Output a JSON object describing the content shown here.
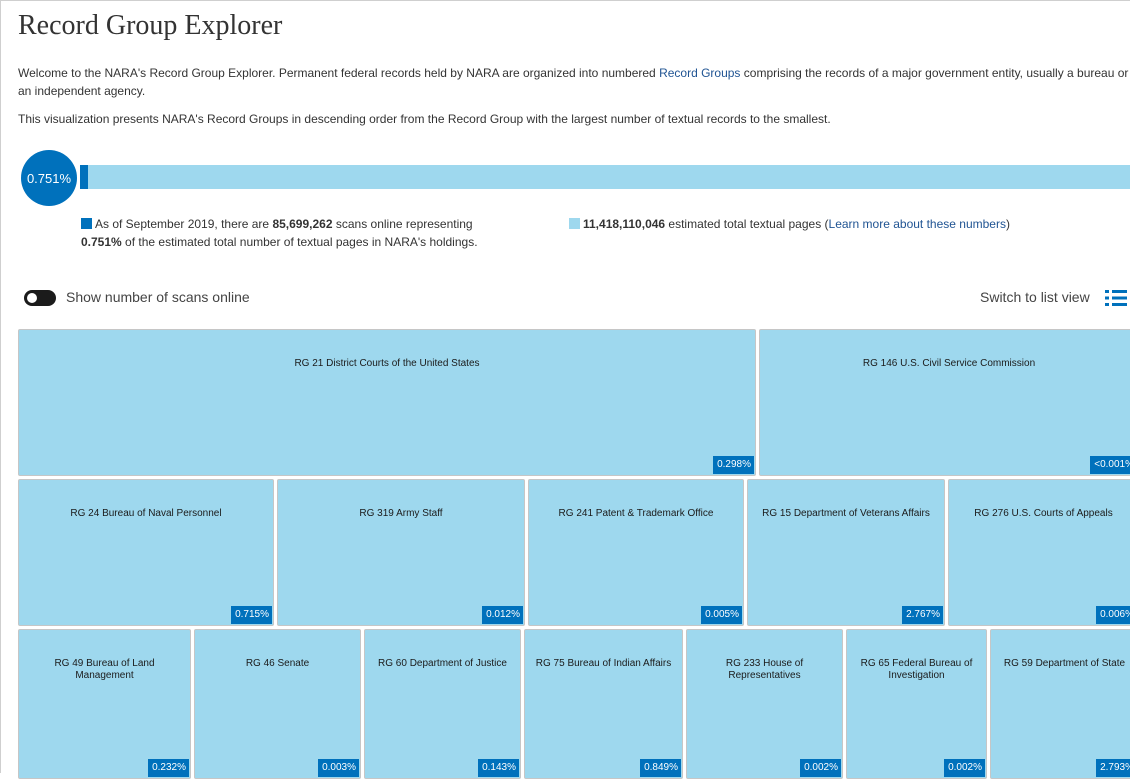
{
  "page_title": "Record Group Explorer",
  "intro": {
    "text_before_link": "Welcome to the NARA's Record Group Explorer. Permanent federal records held by NARA are organized into numbered ",
    "link_text": "Record Groups",
    "text_after_link": " comprising the records of a major government entity, usually a bureau or an independent agency.",
    "visualization_text": "This visualization presents NARA's Record Groups in descending order from the Record Group with the largest number of textual records to the smallest."
  },
  "progress": {
    "percent_label": "0.751%",
    "percent_value": 0.751,
    "fill_color": "#0071bc",
    "track_color": "#9ed8ee"
  },
  "legend": {
    "scans_prefix": "As of September 2019, there are ",
    "scans_count": "85,699,262",
    "scans_suffix": " scans online representing",
    "scans_percent": "0.751%",
    "scans_tail": " of the estimated total number of textual pages in NARA's holdings.",
    "total_pages": "11,418,110,046",
    "total_text": " estimated total textual pages (",
    "learn_more": "Learn more about these numbers",
    "close_paren": ")"
  },
  "controls": {
    "toggle_label": "Show number of scans online",
    "switch_view_label": "Switch to list view",
    "list_icon": "list-icon"
  },
  "tiles": [
    {
      "label": "RG 21 District Courts of the United States",
      "pct": "0.298%"
    },
    {
      "label": "RG 146 U.S. Civil Service Commission",
      "pct": "<0.001%"
    },
    {
      "label": "RG 24 Bureau of Naval Personnel",
      "pct": "0.715%"
    },
    {
      "label": "RG 319 Army Staff",
      "pct": "0.012%"
    },
    {
      "label": "RG 241 Patent & Trademark Office",
      "pct": "0.005%"
    },
    {
      "label": "RG 15 Department of Veterans Affairs",
      "pct": "2.767%"
    },
    {
      "label": "RG 276 U.S. Courts of Appeals",
      "pct": "0.006%"
    },
    {
      "label": "RG 49 Bureau of Land Management",
      "pct": "0.232%"
    },
    {
      "label": "RG 46 Senate",
      "pct": "0.003%"
    },
    {
      "label": "RG 60 Department of Justice",
      "pct": "0.143%"
    },
    {
      "label": "RG 75 Bureau of Indian Affairs",
      "pct": "0.849%"
    },
    {
      "label": "RG 233 House of Representatives",
      "pct": "0.002%"
    },
    {
      "label": "RG 65 Federal Bureau of Investigation",
      "pct": "0.002%"
    },
    {
      "label": "RG 59 Department of State",
      "pct": "2.793%"
    }
  ]
}
